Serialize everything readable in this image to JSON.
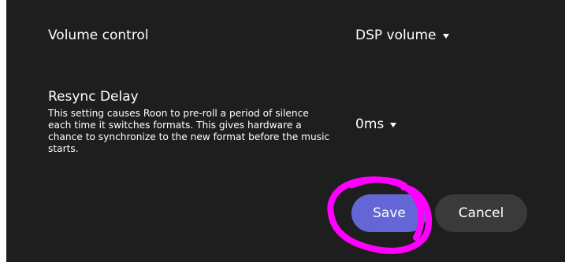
{
  "volume_control": {
    "label": "Volume control",
    "selected": "DSP volume"
  },
  "resync_delay": {
    "title": "Resync Delay",
    "description": "This setting causes Roon to pre-roll a period of silence each time it switches formats. This gives hardware a chance to synchronize to the new format before the music starts.",
    "selected": "0ms"
  },
  "actions": {
    "save_label": "Save",
    "cancel_label": "Cancel"
  },
  "colors": {
    "panel_bg": "#1e1e1e",
    "save_accent": "#6466d6",
    "cancel_bg": "#3a3a3a",
    "annotation": "#ff00ff"
  },
  "icons": {
    "dropdown": "chevron-down-icon"
  }
}
